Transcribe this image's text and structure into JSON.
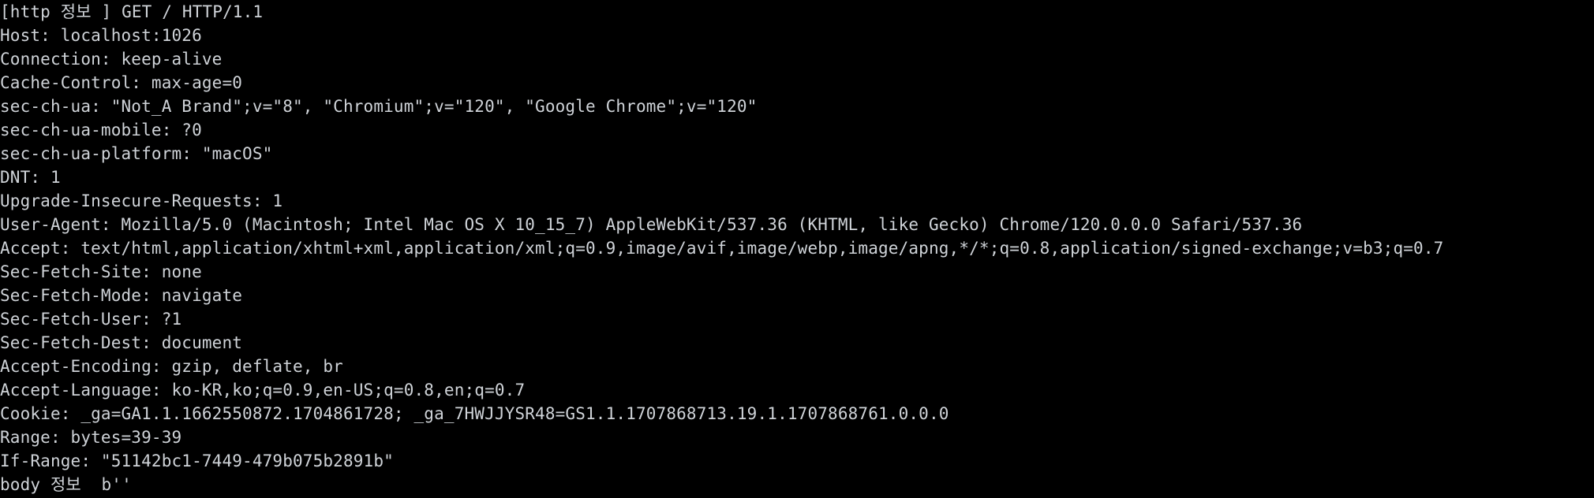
{
  "terminal": {
    "background": "#000000",
    "text_color": "#cfd3d8",
    "lines": [
      "[http 정보 ] GET / HTTP/1.1",
      "Host: localhost:1026",
      "Connection: keep-alive",
      "Cache-Control: max-age=0",
      "sec-ch-ua: \"Not_A Brand\";v=\"8\", \"Chromium\";v=\"120\", \"Google Chrome\";v=\"120\"",
      "sec-ch-ua-mobile: ?0",
      "sec-ch-ua-platform: \"macOS\"",
      "DNT: 1",
      "Upgrade-Insecure-Requests: 1",
      "User-Agent: Mozilla/5.0 (Macintosh; Intel Mac OS X 10_15_7) AppleWebKit/537.36 (KHTML, like Gecko) Chrome/120.0.0.0 Safari/537.36",
      "Accept: text/html,application/xhtml+xml,application/xml;q=0.9,image/avif,image/webp,image/apng,*/*;q=0.8,application/signed-exchange;v=b3;q=0.7",
      "Sec-Fetch-Site: none",
      "Sec-Fetch-Mode: navigate",
      "Sec-Fetch-User: ?1",
      "Sec-Fetch-Dest: document",
      "Accept-Encoding: gzip, deflate, br",
      "Accept-Language: ko-KR,ko;q=0.9,en-US;q=0.8,en;q=0.7",
      "Cookie: _ga=GA1.1.1662550872.1704861728; _ga_7HWJJYSR48=GS1.1.1707868713.19.1.1707868761.0.0.0",
      "Range: bytes=39-39",
      "If-Range: \"51142bc1-7449-479b075b2891b\"",
      "body 정보  b''"
    ]
  }
}
